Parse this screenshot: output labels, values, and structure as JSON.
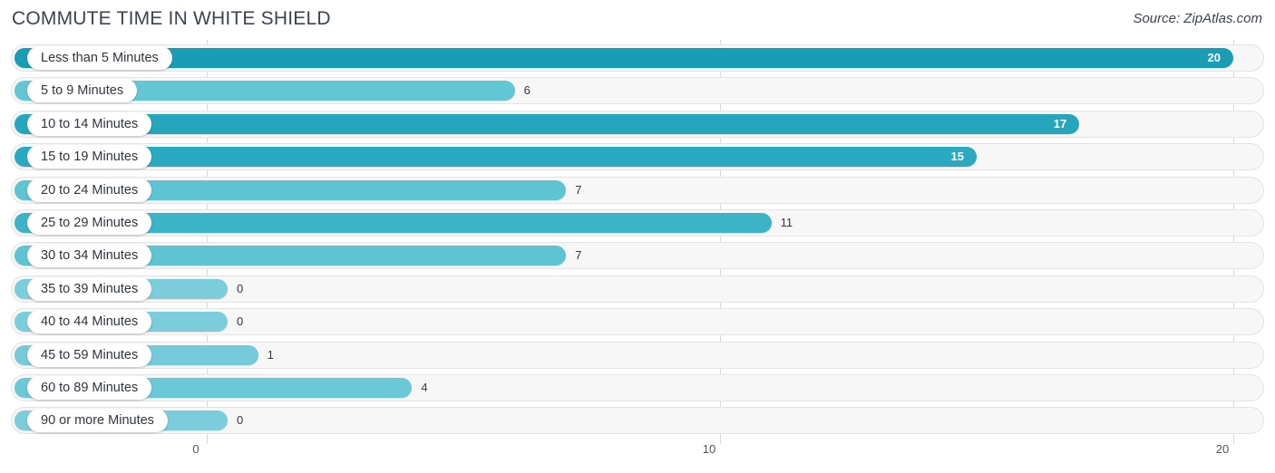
{
  "header": {
    "title": "COMMUTE TIME IN WHITE SHIELD",
    "source": "Source: ZipAtlas.com"
  },
  "chart_data": {
    "type": "bar",
    "orientation": "horizontal",
    "title": "COMMUTE TIME IN WHITE SHIELD",
    "xlabel": "",
    "ylabel": "",
    "xlim": [
      0,
      20
    ],
    "grid": true,
    "legend": null,
    "xticks": [
      "0",
      "10",
      "20"
    ],
    "xtick_values": [
      0,
      10,
      20
    ],
    "categories": [
      "Less than 5 Minutes",
      "5 to 9 Minutes",
      "10 to 14 Minutes",
      "15 to 19 Minutes",
      "20 to 24 Minutes",
      "25 to 29 Minutes",
      "30 to 34 Minutes",
      "35 to 39 Minutes",
      "40 to 44 Minutes",
      "45 to 59 Minutes",
      "60 to 89 Minutes",
      "90 or more Minutes"
    ],
    "values": [
      20,
      6,
      17,
      15,
      7,
      11,
      7,
      0,
      0,
      1,
      4,
      0
    ],
    "value_labels": [
      "20",
      "6",
      "17",
      "15",
      "7",
      "11",
      "7",
      "0",
      "0",
      "1",
      "4",
      "0"
    ],
    "bar_colors": [
      "#199cb4",
      "#63c6d5",
      "#25a6bd",
      "#2ba9c0",
      "#5ec3d2",
      "#3cb3c6",
      "#5ec3d2",
      "#7ccddb",
      "#7ccddb",
      "#74cad9",
      "#6ac8d7",
      "#7ccddb"
    ]
  },
  "colors": {
    "accent": "#2ba9c0",
    "track": "#f7f7f7",
    "track_border": "#e3e3e3",
    "text": "#2f353d",
    "grid": "#d8d8d8"
  }
}
